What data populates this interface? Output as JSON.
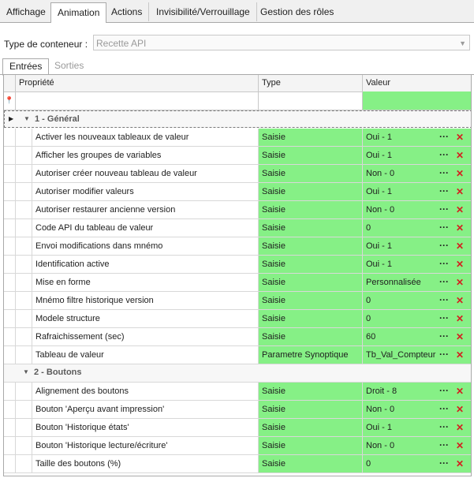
{
  "tabs": [
    {
      "label": "Affichage"
    },
    {
      "label": "Animation"
    },
    {
      "label": "Actions"
    },
    {
      "label": "Invisibilité/Verrouillage"
    },
    {
      "label": "Gestion des rôles"
    }
  ],
  "active_tab": "Animation",
  "container": {
    "label": "Type de conteneur :",
    "value": "Recette API"
  },
  "subtabs": [
    {
      "label": "Entrées"
    },
    {
      "label": "Sorties"
    }
  ],
  "grid": {
    "columns": {
      "property": "Propriété",
      "type": "Type",
      "value": "Valeur"
    },
    "groups": [
      {
        "title": "1 - Général",
        "rows": [
          {
            "property": "Activer les nouveaux tableaux de valeur",
            "type": "Saisie",
            "value": "Oui - 1"
          },
          {
            "property": "Afficher les groupes de variables",
            "type": "Saisie",
            "value": "Oui - 1"
          },
          {
            "property": "Autoriser créer nouveau tableau de valeur",
            "type": "Saisie",
            "value": "Non - 0"
          },
          {
            "property": "Autoriser modifier valeurs",
            "type": "Saisie",
            "value": "Oui - 1"
          },
          {
            "property": "Autoriser restaurer ancienne version",
            "type": "Saisie",
            "value": "Non - 0"
          },
          {
            "property": "Code API du tableau de valeur",
            "type": "Saisie",
            "value": "0"
          },
          {
            "property": "Envoi modifications dans mnémo",
            "type": "Saisie",
            "value": "Oui - 1"
          },
          {
            "property": "Identification active",
            "type": "Saisie",
            "value": "Oui - 1"
          },
          {
            "property": "Mise en forme",
            "type": "Saisie",
            "value": "Personnalisée"
          },
          {
            "property": "Mnémo filtre historique version",
            "type": "Saisie",
            "value": "0"
          },
          {
            "property": "Modele structure",
            "type": "Saisie",
            "value": "0"
          },
          {
            "property": "Rafraichissement (sec)",
            "type": "Saisie",
            "value": "60"
          },
          {
            "property": "Tableau de valeur",
            "type": "Parametre Synoptique",
            "value": "Tb_Val_Compteur"
          }
        ]
      },
      {
        "title": "2 - Boutons",
        "rows": [
          {
            "property": "Alignement des boutons",
            "type": "Saisie",
            "value": "Droit - 8"
          },
          {
            "property": "Bouton 'Aperçu avant impression'",
            "type": "Saisie",
            "value": "Non - 0"
          },
          {
            "property": "Bouton 'Historique états'",
            "type": "Saisie",
            "value": "Oui - 1"
          },
          {
            "property": "Bouton 'Historique lecture/écriture'",
            "type": "Saisie",
            "value": "Non - 0"
          },
          {
            "property": "Taille des boutons (%)",
            "type": "Saisie",
            "value": "0"
          }
        ]
      }
    ],
    "row_action_icons": [
      "ellipsis-icon",
      "delete-x-icon"
    ]
  },
  "colors": {
    "green_cell": "#86f086",
    "delete_red": "#d42020"
  }
}
